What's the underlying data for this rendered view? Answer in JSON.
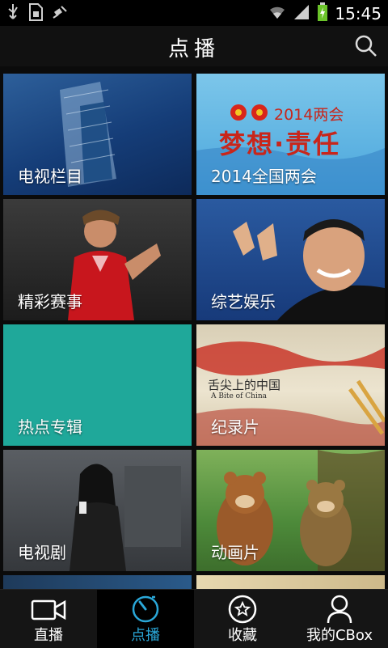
{
  "status_bar": {
    "time": "15:45"
  },
  "app_bar": {
    "title": "点播"
  },
  "tiles": [
    {
      "label": "电视栏目"
    },
    {
      "label": "2014全国两会",
      "banner_year": "2014两会",
      "banner_slogan": "梦想·责任"
    },
    {
      "label": "精彩赛事"
    },
    {
      "label": "综艺娱乐"
    },
    {
      "label": "热点专辑"
    },
    {
      "label": "纪录片",
      "title_cn": "舌尖上的中国",
      "title_en": "A Bite of China"
    },
    {
      "label": "电视剧"
    },
    {
      "label": "动画片"
    }
  ],
  "tabs": [
    {
      "label": "直播",
      "icon": "video-camera-icon",
      "active": false
    },
    {
      "label": "点播",
      "icon": "play-dial-icon",
      "active": true
    },
    {
      "label": "收藏",
      "icon": "star-icon",
      "active": false
    },
    {
      "label": "我的CBox",
      "icon": "person-icon",
      "active": false
    }
  ],
  "colors": {
    "accent": "#2aa7d8",
    "teal_tile": "#1fa89a",
    "background": "#0b0b0b"
  }
}
